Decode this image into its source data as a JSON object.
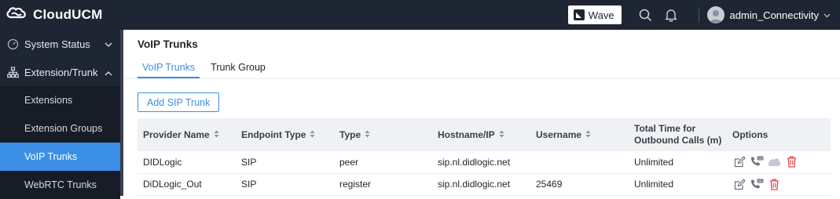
{
  "app": {
    "name": "CloudUCM"
  },
  "topbar": {
    "wave_label": "Wave",
    "user_name": "admin_Connectivity",
    "icons": [
      "search-icon",
      "bell-icon",
      "user-avatar",
      "chevron-down-icon"
    ]
  },
  "sidebar": {
    "items": [
      {
        "label": "System Status",
        "icon": "gauge-icon",
        "expanded": false
      },
      {
        "label": "Extension/Trunk",
        "icon": "org-chart-icon",
        "expanded": true
      }
    ],
    "subitems": [
      {
        "label": "Extensions",
        "active": false
      },
      {
        "label": "Extension Groups",
        "active": false
      },
      {
        "label": "VoIP Trunks",
        "active": true
      },
      {
        "label": "WebRTC Trunks",
        "active": false
      }
    ]
  },
  "main": {
    "title": "VoIP Trunks",
    "tabs": [
      {
        "label": "VoIP Trunks",
        "active": true
      },
      {
        "label": "Trunk Group",
        "active": false
      }
    ],
    "add_button": "Add SIP Trunk",
    "table": {
      "columns": {
        "provider": "Provider Name",
        "endpoint": "Endpoint Type",
        "type": "Type",
        "host": "Hostname/IP",
        "username": "Username",
        "total_time_1": "Total Time for",
        "total_time_2": "Outbound Calls (m)",
        "options": "Options"
      },
      "rows": [
        {
          "provider": "DIDLogic",
          "endpoint": "SIP",
          "type": "peer",
          "host": "sip.nl.didlogic.net",
          "username": "",
          "total_time": "Unlimited",
          "options": [
            "edit-icon",
            "did-phone-icon",
            "cloud-icon",
            "delete-icon"
          ]
        },
        {
          "provider": "DiDLogic_Out",
          "endpoint": "SIP",
          "type": "register",
          "host": "sip.nl.didlogic.net",
          "username": "25469",
          "total_time": "Unlimited",
          "options": [
            "edit-icon",
            "did-phone-icon",
            "delete-icon"
          ]
        }
      ]
    }
  },
  "colors": {
    "topbar_bg": "#1f2633",
    "accent": "#3b8fe6",
    "delete": "#e5484d",
    "header_bg": "#f0f1f4"
  }
}
